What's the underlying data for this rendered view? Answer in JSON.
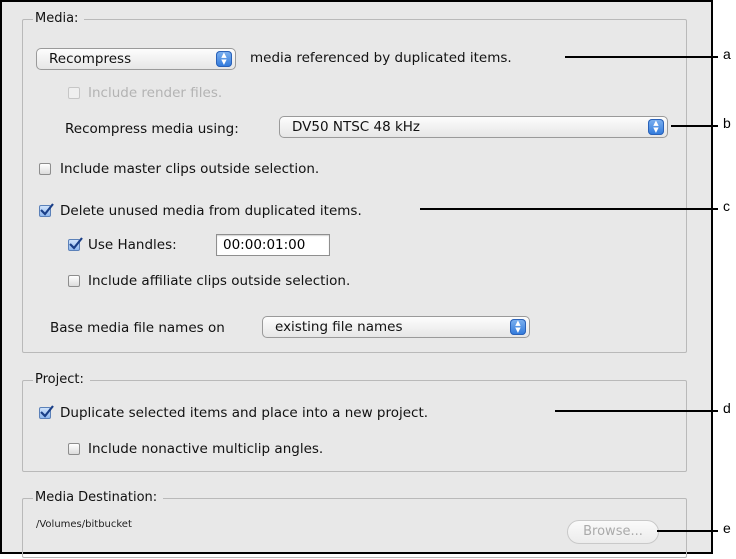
{
  "media": {
    "title": "Media:",
    "action_popup": "Recompress",
    "action_suffix": "media referenced by duplicated items.",
    "include_render_label": "Include render files.",
    "recompress_using_label": "Recompress media using:",
    "recompress_setting": "DV50 NTSC 48 kHz",
    "include_master_label": "Include master clips outside selection.",
    "delete_unused_label": "Delete unused media from duplicated items.",
    "use_handles_label": "Use Handles:",
    "handles_value": "00:00:01:00",
    "include_affiliate_label": "Include affiliate clips outside selection.",
    "base_names_label": "Base media file names on",
    "base_names_value": "existing file names"
  },
  "project": {
    "title": "Project:",
    "duplicate_label": "Duplicate selected items and place into a new project.",
    "nonactive_label": "Include nonactive multiclip angles."
  },
  "destination": {
    "title": "Media Destination:",
    "path": "/Volumes/bitbucket",
    "browse_label": "Browse..."
  },
  "checkboxes": {
    "include_render": false,
    "include_master": false,
    "delete_unused": true,
    "use_handles": true,
    "include_affiliate": false,
    "duplicate_project": true,
    "include_nonactive": false
  },
  "callouts": [
    "a",
    "b",
    "c",
    "d",
    "e"
  ]
}
